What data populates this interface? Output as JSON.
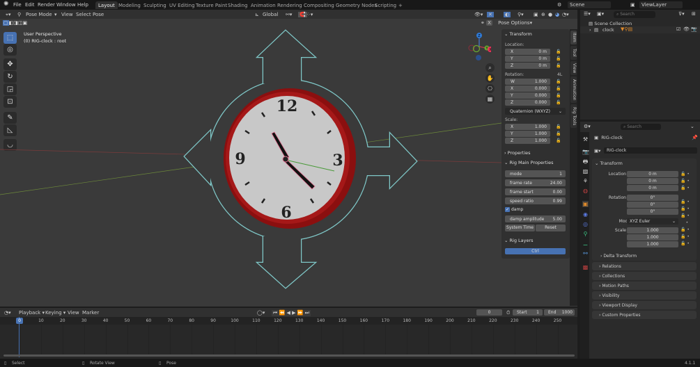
{
  "topbar": {
    "menus": [
      "File",
      "Edit",
      "Render",
      "Window",
      "Help"
    ],
    "workspaces": [
      "Layout",
      "Modeling",
      "Sculpting",
      "UV Editing",
      "Texture Paint",
      "Shading",
      "Animation",
      "Rendering",
      "Compositing",
      "Geometry Nodes",
      "Scripting"
    ],
    "active_workspace": "Layout",
    "add_tab": "+",
    "scene": "Scene",
    "view_layer": "ViewLayer"
  },
  "viewport_header": {
    "mode": "Pose Mode",
    "menus": [
      "View",
      "Select",
      "Pose"
    ],
    "orientation": "Global",
    "pose_options": "Pose Options",
    "x_mirror": "X"
  },
  "viewport": {
    "view_name": "User Perspective",
    "object_info": "(0) RIG-clock : root",
    "clock_numbers": [
      "12",
      "3",
      "6",
      "9"
    ],
    "gizmo_axes": [
      "Z",
      "Y",
      "X"
    ]
  },
  "npanel": {
    "tabs": [
      "Item",
      "Tool",
      "View",
      "Animation",
      "Rig Tools"
    ],
    "transform": {
      "title": "Transform",
      "location_label": "Location:",
      "location": [
        {
          "axis": "X",
          "value": "0 m"
        },
        {
          "axis": "Y",
          "value": "0 m"
        },
        {
          "axis": "Z",
          "value": "0 m"
        }
      ],
      "rotation_label": "Rotation:",
      "rotation_mode_short": "4L",
      "rotation": [
        {
          "axis": "W",
          "value": "1.000"
        },
        {
          "axis": "X",
          "value": "0.000"
        },
        {
          "axis": "Y",
          "value": "0.000"
        },
        {
          "axis": "Z",
          "value": "0.000"
        }
      ],
      "rotation_mode": "Quaternion (WXYZ)",
      "scale_label": "Scale:",
      "scale": [
        {
          "axis": "X",
          "value": "1.000"
        },
        {
          "axis": "Y",
          "value": "1.000"
        },
        {
          "axis": "Z",
          "value": "1.000"
        }
      ]
    },
    "properties_title": "Properties",
    "rig_main": {
      "title": "Rig Main Properties",
      "fields": [
        {
          "label": "mode",
          "value": "1"
        },
        {
          "label": "frame rate",
          "value": "24.00"
        },
        {
          "label": "frame start",
          "value": "0.00"
        },
        {
          "label": "speed ratio",
          "value": "0.99"
        }
      ],
      "damp_label": "damp",
      "damp_checked": true,
      "damp_amplitude": {
        "label": "damp amplitude",
        "value": "5.00"
      },
      "system_time": "System Time",
      "reset": "Reset"
    },
    "rig_layers": {
      "title": "Rig Layers",
      "ctrl": "Ctrl"
    }
  },
  "outliner": {
    "search_placeholder": "Search",
    "scene_collection": "Scene Collection",
    "items": [
      {
        "name": "clock"
      }
    ]
  },
  "properties": {
    "search_placeholder": "Search",
    "object_name": "RIG-clock",
    "object_field": "RIG-clock",
    "transform_title": "Transform",
    "rows": [
      {
        "label": "Location X",
        "value": "0 m"
      },
      {
        "label": "Y",
        "value": "0 m"
      },
      {
        "label": "Z",
        "value": "0 m"
      },
      {
        "label": "Rotation X",
        "value": "0°"
      },
      {
        "label": "Y",
        "value": "0°"
      },
      {
        "label": "Z",
        "value": "0°"
      },
      {
        "label": "Mode",
        "value": "XYZ Euler"
      },
      {
        "label": "Scale X",
        "value": "1.000"
      },
      {
        "label": "Y",
        "value": "1.000"
      },
      {
        "label": "Z",
        "value": "1.000"
      }
    ],
    "delta_transform": "Delta Transform",
    "sections": [
      "Relations",
      "Collections",
      "Motion Paths",
      "Visibility",
      "Viewport Display",
      "Custom Properties"
    ]
  },
  "timeline": {
    "menus": [
      "Playback",
      "Keying",
      "View",
      "Marker"
    ],
    "current_frame": "0",
    "start_label": "Start",
    "start": "1",
    "end_label": "End",
    "end": "1000",
    "ticks": [
      "0",
      "10",
      "20",
      "30",
      "40",
      "50",
      "60",
      "70",
      "80",
      "90",
      "100",
      "110",
      "120",
      "130",
      "140",
      "150",
      "160",
      "170",
      "180",
      "190",
      "200",
      "210",
      "220",
      "230",
      "240",
      "250"
    ]
  },
  "status": {
    "hints": [
      "Select",
      "Rotate View",
      "Pose"
    ],
    "version": "4.1.1"
  },
  "colors": {
    "accent": "#4772b3",
    "clock_rim": "#8b0f0f",
    "rig_outline": "#7fc8c8",
    "face": "#c8c8c8"
  }
}
